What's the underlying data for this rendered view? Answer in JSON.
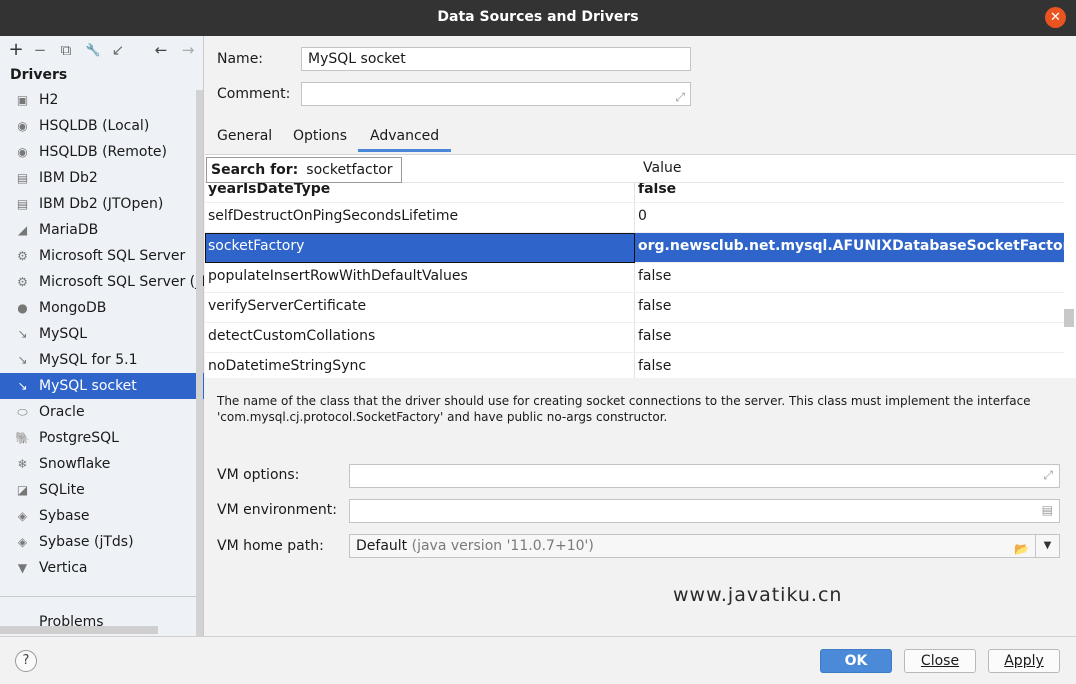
{
  "window": {
    "title": "Data Sources and Drivers",
    "close_glyph": "✕"
  },
  "sidebar": {
    "toolbar": [
      {
        "name": "add-icon",
        "glyph": "+"
      },
      {
        "name": "remove-icon",
        "glyph": "−"
      },
      {
        "name": "duplicate-icon",
        "glyph": "⧉"
      },
      {
        "name": "wrench-icon",
        "glyph": "🔧"
      },
      {
        "name": "go-to-icon",
        "glyph": "↙"
      },
      {
        "name": "back-icon",
        "glyph": "←"
      },
      {
        "name": "forward-icon",
        "glyph": "→"
      }
    ],
    "heading": "Drivers",
    "items": [
      {
        "label": "H2",
        "icon": "h2-icon",
        "glyph": "▣"
      },
      {
        "label": "HSQLDB (Local)",
        "icon": "hsqldb-icon",
        "glyph": "◉"
      },
      {
        "label": "HSQLDB (Remote)",
        "icon": "hsqldb-icon",
        "glyph": "◉"
      },
      {
        "label": "IBM Db2",
        "icon": "ibm-icon",
        "glyph": "▤"
      },
      {
        "label": "IBM Db2 (JTOpen)",
        "icon": "ibm-icon",
        "glyph": "▤"
      },
      {
        "label": "MariaDB",
        "icon": "mariadb-icon",
        "glyph": "◢"
      },
      {
        "label": "Microsoft SQL Server",
        "icon": "mssql-icon",
        "glyph": "⚙"
      },
      {
        "label": "Microsoft SQL Server (jTds)",
        "icon": "mssql-icon",
        "glyph": "⚙"
      },
      {
        "label": "MongoDB",
        "icon": "mongodb-icon",
        "glyph": "●"
      },
      {
        "label": "MySQL",
        "icon": "mysql-icon",
        "glyph": "↘"
      },
      {
        "label": "MySQL for 5.1",
        "icon": "mysql-icon",
        "glyph": "↘"
      },
      {
        "label": "MySQL socket",
        "icon": "mysql-icon",
        "glyph": "↘",
        "selected": true
      },
      {
        "label": "Oracle",
        "icon": "oracle-icon",
        "glyph": "⬭"
      },
      {
        "label": "PostgreSQL",
        "icon": "postgresql-icon",
        "glyph": "🐘"
      },
      {
        "label": "Snowflake",
        "icon": "snowflake-icon",
        "glyph": "❄"
      },
      {
        "label": "SQLite",
        "icon": "sqlite-icon",
        "glyph": "◪"
      },
      {
        "label": "Sybase",
        "icon": "sybase-icon",
        "glyph": "◈"
      },
      {
        "label": "Sybase (jTds)",
        "icon": "sybase-icon",
        "glyph": "◈"
      },
      {
        "label": "Vertica",
        "icon": "vertica-icon",
        "glyph": "▼"
      }
    ],
    "problems_label": "Problems"
  },
  "form": {
    "name_label": "Name:",
    "name_value": "MySQL socket",
    "comment_label": "Comment:",
    "comment_value": "",
    "expand_glyph": "⤢"
  },
  "tabs": [
    {
      "label": "General"
    },
    {
      "label": "Options"
    },
    {
      "label": "Advanced",
      "active": true
    }
  ],
  "table": {
    "search_label": "Search for:",
    "search_value": "socketfactor",
    "value_header": "Value",
    "rows": [
      {
        "key": "yearIsDateType",
        "value": "false"
      },
      {
        "key": "selfDestructOnPingSecondsLifetime",
        "value": "0"
      },
      {
        "key": "socketFactory",
        "value": "org.newsclub.net.mysql.AFUNIXDatabaseSocketFactory",
        "selected": true
      },
      {
        "key": "populateInsertRowWithDefaultValues",
        "value": "false"
      },
      {
        "key": "verifyServerCertificate",
        "value": "false"
      },
      {
        "key": "detectCustomCollations",
        "value": "false"
      },
      {
        "key": "noDatetimeStringSync",
        "value": "false"
      }
    ]
  },
  "description": "The name of the class that the driver should use for creating socket connections to the server. This class must implement the interface 'com.mysql.cj.protocol.SocketFactory' and have public no-args constructor.",
  "vm": {
    "options_label": "VM options:",
    "environment_label": "VM environment:",
    "home_label": "VM home path:",
    "home_value": "Default",
    "home_hint": "(java version '11.0.7+10')",
    "folder_glyph": "📂",
    "doc_glyph": "▤",
    "arrow_glyph": "▼"
  },
  "watermark": "www.javatiku.cn",
  "footer": {
    "help": "?",
    "ok": "OK",
    "close": "Close",
    "apply": "Apply"
  },
  "colors": {
    "selection": "#2f65ca",
    "titlebar": "#333333",
    "close_button": "#e95420",
    "primary_button": "#4a8ad9"
  }
}
